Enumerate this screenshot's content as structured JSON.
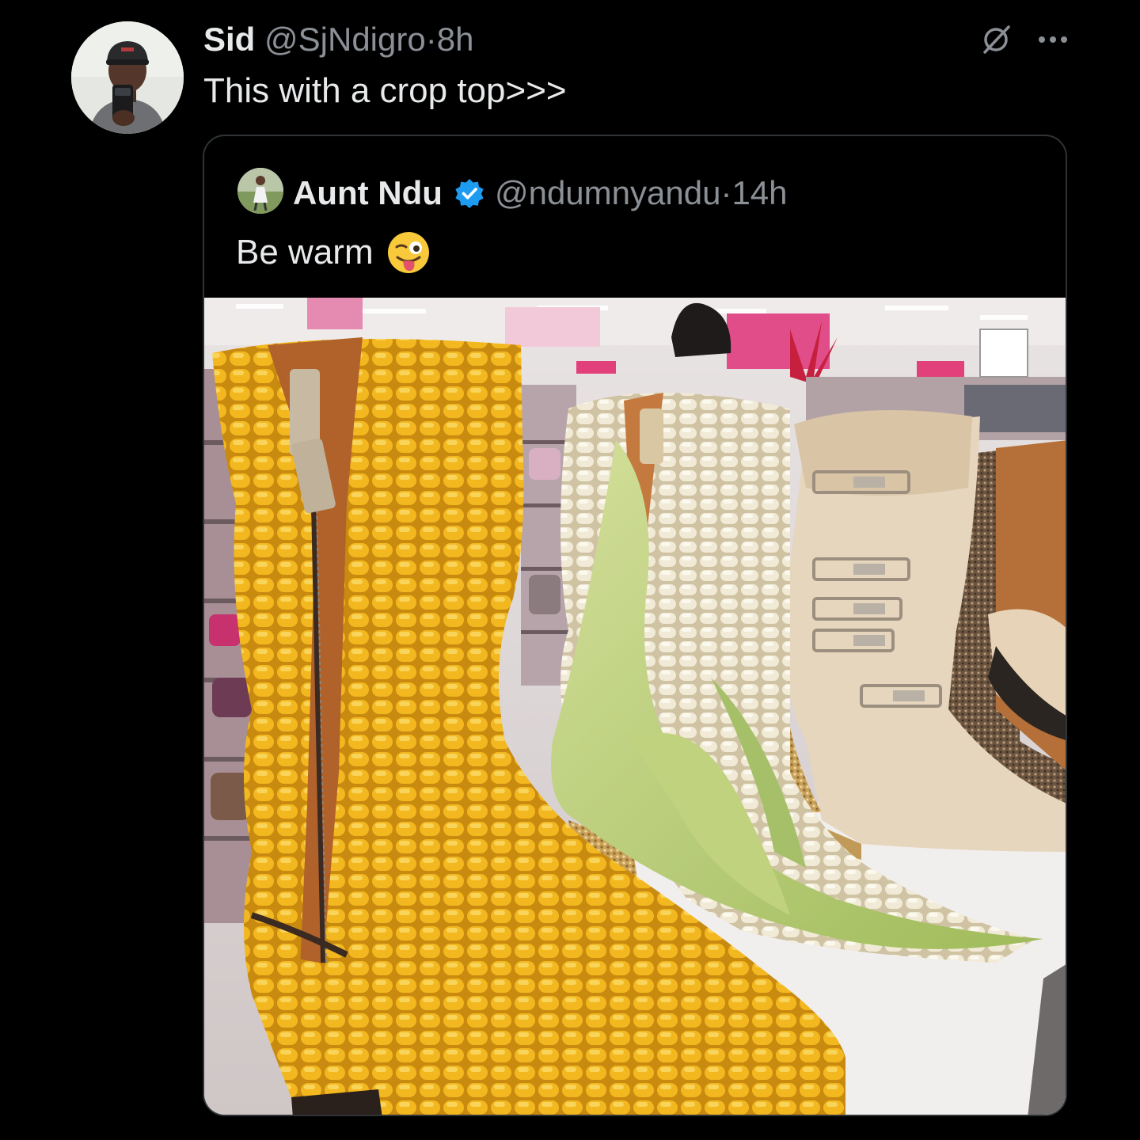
{
  "tweet": {
    "author_name": "Sid",
    "author_handle": "@SjNdigro",
    "separator": "·",
    "time": "8h",
    "text": "This with a crop top>>>",
    "avatar_icon": "user-avatar-photo",
    "grok_icon": "grok-icon",
    "more_icon": "more-options-icon"
  },
  "quote": {
    "author_name": "Aunt Ndu",
    "verified_icon": "verified-badge-icon",
    "author_handle": "@ndumnyandu",
    "separator": "·",
    "time": "14h",
    "text": "Be warm",
    "emoji_icon": "winking-face-with-tongue-emoji",
    "media_icon": "photo-corn-cob-boots-in-shoe-store"
  },
  "colors": {
    "background": "#000000",
    "primary_text": "#e7e9ea",
    "secondary_text": "#8b9096",
    "border": "#2f3336",
    "verified": "#1d9bf0",
    "corn_yellow": "#f3b81f",
    "corn_white": "#f1ead6",
    "husk_green": "#b9cf7a"
  }
}
